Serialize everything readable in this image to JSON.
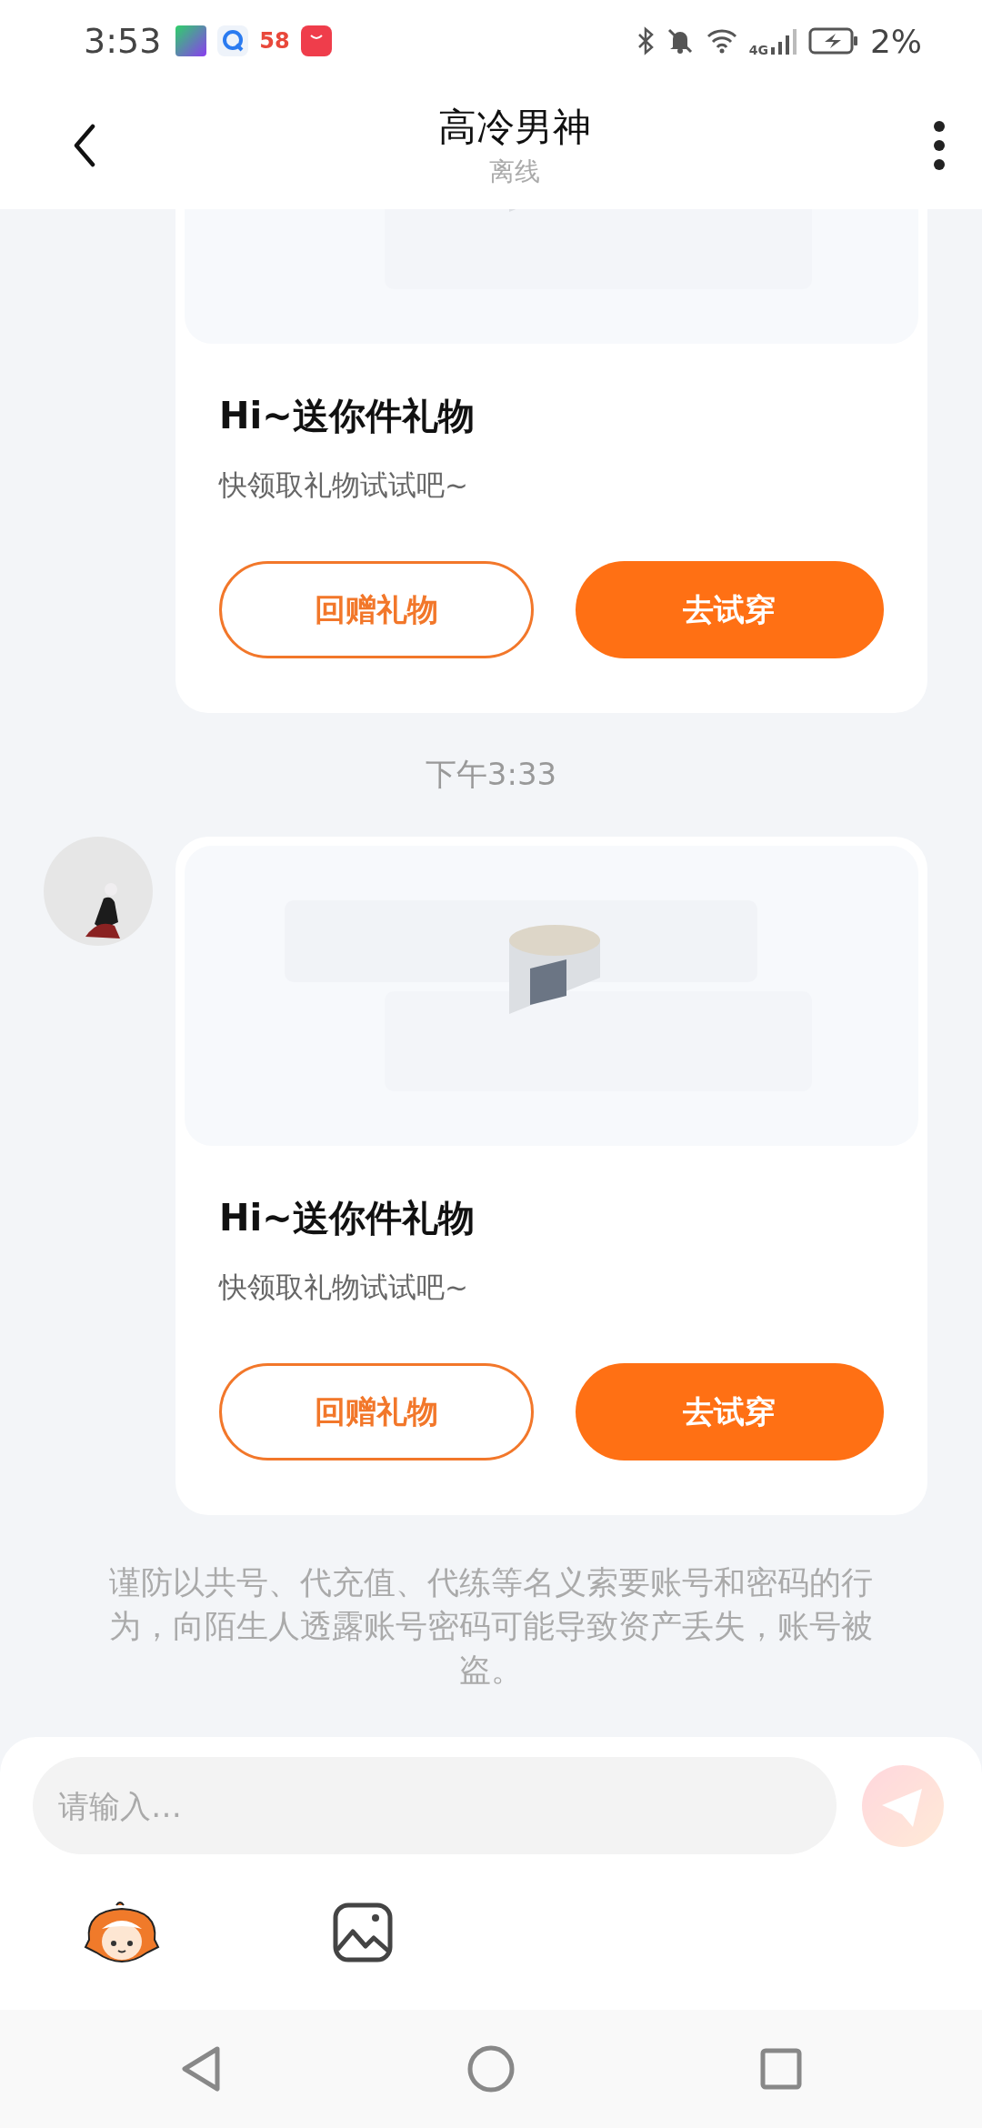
{
  "status_bar": {
    "time": "3:53",
    "app_badge": "58",
    "battery": "2%",
    "network": "4G"
  },
  "header": {
    "title": "高冷男神",
    "status": "离线"
  },
  "messages": [
    {
      "kind": "gift",
      "avatar": false,
      "title": "Hi~送你件礼物",
      "text": "快领取礼物试试吧~",
      "buttons": [
        {
          "label": "回赠礼物",
          "kind": "outline"
        },
        {
          "label": "去试穿",
          "kind": "filled"
        }
      ]
    },
    {
      "kind": "time",
      "text": "下午3:33"
    },
    {
      "kind": "gift",
      "avatar": true,
      "title": "Hi~送你件礼物",
      "text": "快领取礼物试试吧~",
      "buttons": [
        {
          "label": "回赠礼物",
          "kind": "outline"
        },
        {
          "label": "去试穿",
          "kind": "filled"
        }
      ]
    }
  ],
  "notice": "谨防以共号、代充值、代练等名义索要账号和密码的行为，向陌生人透露账号密码可能导致资产丢失，账号被盗。",
  "composer": {
    "placeholder": "请输入…",
    "send_disabled": true
  }
}
